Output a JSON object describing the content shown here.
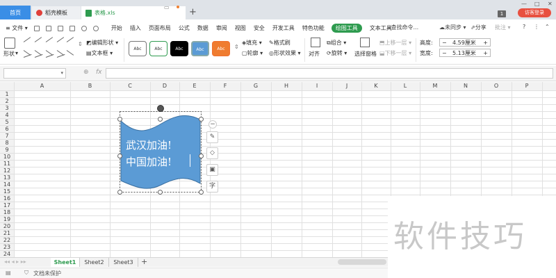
{
  "titlebar": {
    "tabs": [
      {
        "label": "首页"
      },
      {
        "label": "稻壳模板"
      },
      {
        "label": "表格.xls"
      }
    ],
    "badge": "1",
    "login": "访客登录"
  },
  "menubar": {
    "file": "≡ 文件 ▾",
    "items": [
      "开始",
      "插入",
      "页面布局",
      "公式",
      "数据",
      "审阅",
      "视图",
      "安全",
      "开发工具",
      "特色功能"
    ],
    "active": "绘图工具",
    "after": "文本工具",
    "search": "查找命令...",
    "sync": "未同步",
    "share": "分享",
    "comment": "批注"
  },
  "ribbon": {
    "shape_label": "形状",
    "edit_shape": "编辑形状",
    "text_box": "文本框",
    "gallery": [
      "Abc",
      "Abc",
      "Abc",
      "Abc",
      "Abc"
    ],
    "fill": "填充",
    "outline": "轮廓",
    "format_brush": "格式刷",
    "shape_effects": "形状效果",
    "align": "对齐",
    "group": "组合",
    "rotate": "旋转",
    "selection_pane": "选择窗格",
    "bring_forward": "上移一层",
    "send_backward": "下移一层",
    "height_label": "高度:",
    "height_value": "4.59厘米",
    "width_label": "宽度:",
    "width_value": "5.13厘米"
  },
  "formula": {
    "fx": "fx"
  },
  "grid": {
    "columns": [
      "A",
      "B",
      "C",
      "D",
      "E",
      "F",
      "G",
      "H",
      "I",
      "J",
      "K",
      "L",
      "M",
      "N",
      "O",
      "P"
    ],
    "rows": [
      "1",
      "2",
      "3",
      "4",
      "5",
      "6",
      "7",
      "8",
      "9",
      "10",
      "11",
      "12",
      "13",
      "14",
      "15",
      "16",
      "17",
      "18",
      "19",
      "20",
      "21",
      "22",
      "23",
      "24"
    ]
  },
  "shape": {
    "line1": "武汉加油!",
    "line2": "中国加油!",
    "fill_color": "#5b9bd5"
  },
  "sheets": [
    "Sheet1",
    "Sheet2",
    "Sheet3"
  ],
  "status": {
    "protect": "文档未保护"
  },
  "watermark": "软件技巧",
  "colors": {
    "accent": "#2e9b4f",
    "home_tab": "#3a8ee6",
    "login": "#e85040"
  }
}
